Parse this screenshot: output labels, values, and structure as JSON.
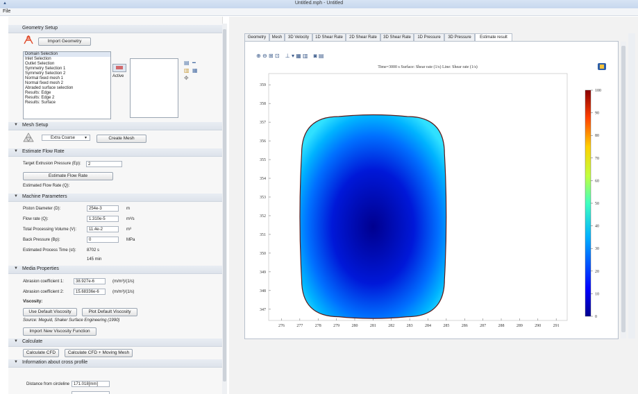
{
  "window": {
    "title": "Untitled.mph - Untitled"
  },
  "menu": {
    "file": "File"
  },
  "geometry_setup": {
    "header": "Geometry Setup",
    "import_button": "Import Geometry",
    "selections": [
      "Domain Selection",
      "Inlet Selection",
      "Outlet Selection",
      "Symmetry Selection 1",
      "Symmetry Selection 2",
      "Normal fixed mesh 1",
      "Normal fixed mesh 2",
      "Abraded surface selection",
      "Results: Edge",
      "Results: Edge 2",
      "Results: Surface"
    ],
    "active_label": "Active"
  },
  "mesh_setup": {
    "header": "Mesh Setup",
    "mesh_size": "Extra Coarse",
    "create_button": "Create Mesh"
  },
  "flow_rate": {
    "header": "Estimate Flow Rate",
    "target_label": "Target Extrusion Pressure (Ep):",
    "target_value": "2",
    "estimate_button": "Estimate Flow Rate",
    "estimated_label": "Estimated Flow Rate (Q):"
  },
  "machine": {
    "header": "Machine Parameters",
    "params": [
      {
        "label": "Piston Diameter (D):",
        "value": "254e-3",
        "unit": "m"
      },
      {
        "label": "Flow rate (Q):",
        "value": "1.310e-5",
        "unit": "m³/s"
      },
      {
        "label": "Total Processing Volume (V):",
        "value": "11.4e-2",
        "unit": "m³"
      },
      {
        "label": "Back Pressure (Bp):",
        "value": "0",
        "unit": "MPa"
      }
    ],
    "time_label": "Estimated Process Time (st):",
    "time_s": "8702 s",
    "time_min": "145  min"
  },
  "media": {
    "header": "Media Properties",
    "coef1_label": "Abrasion coefficient 1:",
    "coef1_value": "38.927e-6",
    "coef1_unit": "(m/m³)/(1/s)",
    "coef2_label": "Abrasion coefficient 2:",
    "coef2_value": "15.68336e-6",
    "coef2_unit": "(m/m³)/(1/s)",
    "viscosity_label": "Viscosity:",
    "default_button": "Use Default Viscosity",
    "plot_button": "Plot Default Viscosity",
    "source": "Source: Meguid, Shaker Surface Engineering (1990)",
    "import_button": "Import New Viscosity Function"
  },
  "calculate": {
    "header": "Calculate",
    "cfd_button": "Calculate CFD",
    "cfd_mesh_button": "Calculate CFD + Moving Mesh"
  },
  "cross_profile": {
    "header": "Information about cross profile",
    "distance_label": "Distance from circleline",
    "distance_value": "171.018[mm]"
  },
  "tabs": [
    "Geometry",
    "Mesh",
    "3D Velocity",
    "1D Shear Rate",
    "2D Shear Rate",
    "3D Shear Rate",
    "1D Pressure",
    "3D Pressure",
    "Estimate result"
  ],
  "plot": {
    "title": "Time=3000 s  Surface: Shear rate (1/s)  Line: Shear rate (1/s)",
    "colors": {
      "outline": "#5a1a1a",
      "accent": "#0000c8"
    }
  },
  "chart_data": {
    "type": "heatmap",
    "title": "Time=3000 s  Surface: Shear rate (1/s)  Line: Shear rate (1/s)",
    "x_ticks": [
      276,
      277,
      278,
      279,
      280,
      281,
      282,
      283,
      284,
      285,
      286,
      287,
      288,
      289,
      290,
      291
    ],
    "y_ticks": [
      347,
      348,
      349,
      350,
      351,
      352,
      353,
      354,
      355,
      356,
      357,
      358,
      359
    ],
    "xlim": [
      275.3,
      291.6
    ],
    "ylim": [
      346.4,
      359.6
    ],
    "colorbar": {
      "ticks": [
        0,
        10,
        20,
        30,
        40,
        50,
        60,
        70,
        80,
        90,
        100
      ],
      "range": [
        0,
        100
      ]
    },
    "shape": "rounded rectangle",
    "extent_x": [
      277.1,
      284.9
    ],
    "extent_y": [
      346.6,
      357.3
    ]
  }
}
